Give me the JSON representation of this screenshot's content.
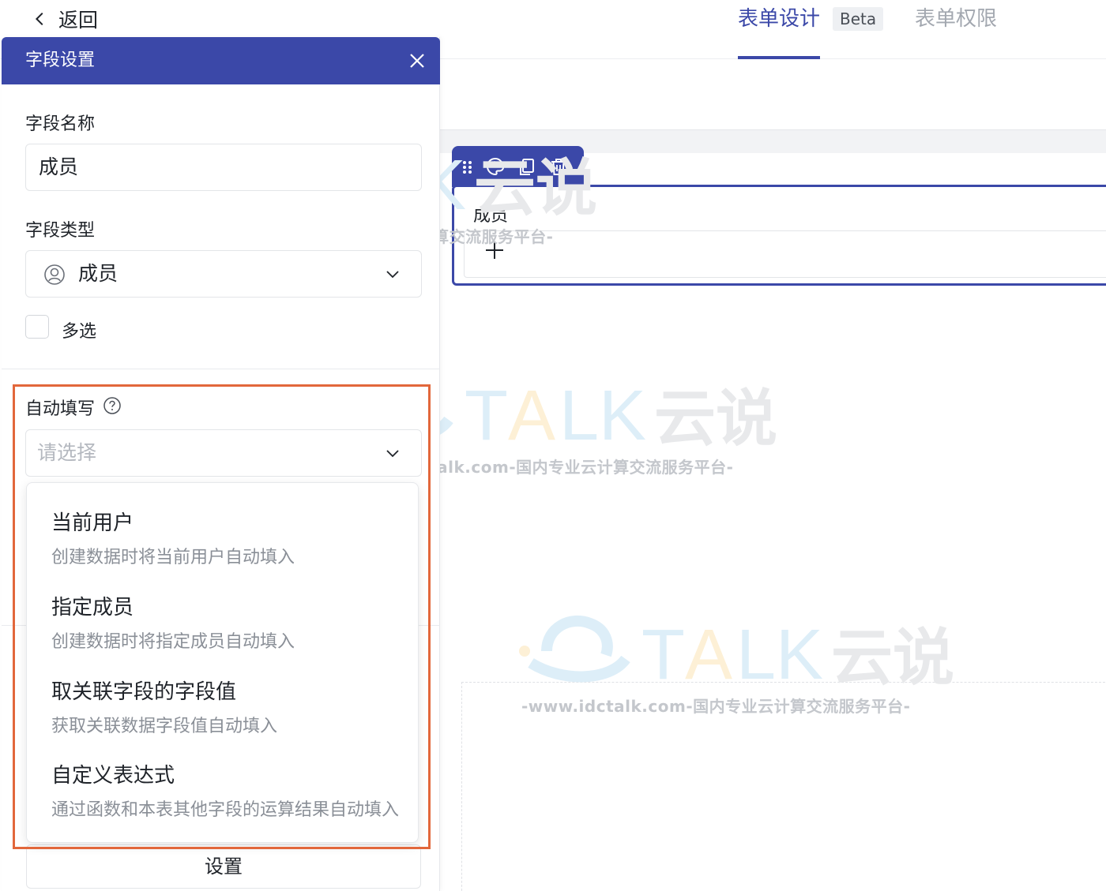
{
  "header": {
    "back_label": "返回",
    "tabs": [
      {
        "label": "表单设计",
        "active": true
      },
      {
        "label": "表单权限",
        "active": false
      }
    ],
    "beta_badge": "Beta"
  },
  "panel": {
    "title": "字段设置",
    "field_name": {
      "label": "字段名称",
      "value": "成员"
    },
    "field_type": {
      "label": "字段类型",
      "value": "成员",
      "icon": "person-icon"
    },
    "multi_select": {
      "label": "多选",
      "checked": false
    },
    "auto_fill": {
      "label": "自动填写",
      "placeholder": "请选择",
      "options": [
        {
          "title": "当前用户",
          "desc": "创建数据时将当前用户自动填入"
        },
        {
          "title": "指定成员",
          "desc": "创建数据时将指定成员自动填入"
        },
        {
          "title": "取关联字段的字段值",
          "desc": "获取关联数据字段值自动填入"
        },
        {
          "title": "自定义表达式",
          "desc": "通过函数和本表其他字段的运算结果自动填入"
        }
      ]
    },
    "settings_button": "设置"
  },
  "canvas": {
    "field_label": "成员",
    "toolbar_icons": [
      "drag-handle-icon",
      "palette-icon",
      "copy-icon",
      "trash-icon"
    ]
  },
  "watermark": {
    "brand": "TALK 云说",
    "tagline": "-www.idctalk.com-国内专业云计算交流服务平台-"
  },
  "colors": {
    "primary": "#3b48a8",
    "highlight": "#e2673b",
    "placeholder": "#b4b8bf",
    "description": "#8a8f97"
  }
}
